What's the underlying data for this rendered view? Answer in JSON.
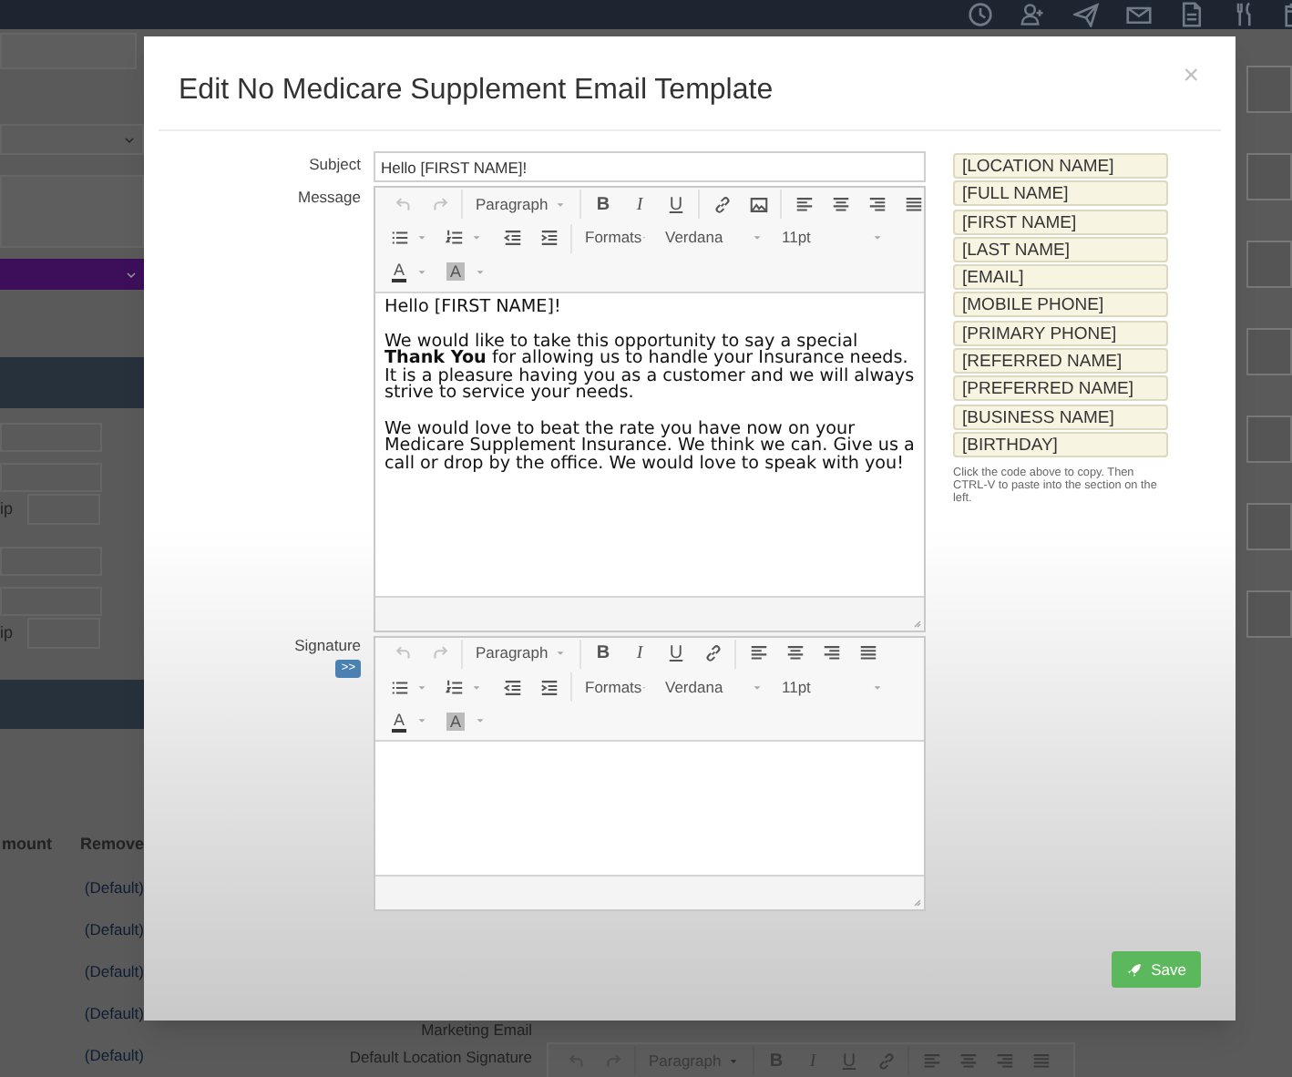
{
  "background_page": {
    "left_labels": [
      "ip",
      "ip"
    ],
    "table": {
      "columns": [
        "mount",
        "Remove"
      ],
      "rows": [
        "(Default)",
        "(Default)",
        "(Default)",
        "(Default)",
        "(Default)"
      ]
    },
    "bottom_labels": [
      "Marketing Email",
      "Default Location Signature"
    ],
    "bottom_toolbar": {
      "rows": [
        {
          "groups": [
            {
              "items": [
                {
                  "kind": "undo",
                  "disabled": true
                },
                {
                  "kind": "redo",
                  "disabled": true
                }
              ]
            },
            {
              "items": [
                {
                  "kind": "block-select",
                  "value": "Paragraph",
                  "disabled": false
                }
              ]
            },
            {
              "items": [
                {
                  "kind": "bold",
                  "label": "B",
                  "disabled": false
                },
                {
                  "kind": "italic",
                  "label": "I",
                  "disabled": false
                },
                {
                  "kind": "underline",
                  "label": "U",
                  "disabled": false
                },
                {
                  "kind": "link",
                  "disabled": false
                }
              ]
            },
            {
              "items": [
                {
                  "kind": "align-left",
                  "disabled": false
                },
                {
                  "kind": "align-center",
                  "disabled": false
                },
                {
                  "kind": "align-right",
                  "disabled": false
                },
                {
                  "kind": "justify",
                  "disabled": false
                }
              ]
            }
          ]
        }
      ]
    }
  },
  "modal": {
    "title": "Edit No Medicare Supplement Email Template",
    "close": "×",
    "subject": {
      "label": "Subject",
      "value": "Hello [FIRST NAME]!"
    },
    "message": {
      "label": "Message",
      "toolbar": {
        "rows": [
          {
            "groups": [
              {
                "items": [
                  {
                    "kind": "undo",
                    "disabled": true
                  },
                  {
                    "kind": "redo",
                    "disabled": true
                  }
                ]
              },
              {
                "items": [
                  {
                    "kind": "block-select",
                    "value": "Paragraph",
                    "disabled": false
                  }
                ]
              },
              {
                "items": [
                  {
                    "kind": "bold",
                    "label": "B",
                    "disabled": false
                  },
                  {
                    "kind": "italic",
                    "label": "I",
                    "disabled": false
                  },
                  {
                    "kind": "underline",
                    "label": "U",
                    "disabled": false
                  }
                ]
              },
              {
                "items": [
                  {
                    "kind": "link",
                    "disabled": false
                  },
                  {
                    "kind": "image",
                    "disabled": false
                  }
                ]
              },
              {
                "items": [
                  {
                    "kind": "align-left",
                    "disabled": false
                  },
                  {
                    "kind": "align-center",
                    "disabled": false
                  },
                  {
                    "kind": "align-right",
                    "disabled": false
                  },
                  {
                    "kind": "justify",
                    "disabled": false
                  }
                ]
              }
            ]
          },
          {
            "groups": [
              {
                "items": [
                  {
                    "kind": "bullet-list",
                    "disabled": false
                  },
                  {
                    "kind": "numbered-list",
                    "disabled": false
                  },
                  {
                    "kind": "outdent",
                    "disabled": false
                  },
                  {
                    "kind": "indent",
                    "disabled": false
                  }
                ]
              },
              {
                "items": [
                  {
                    "kind": "formats-menu",
                    "value": "Formats",
                    "disabled": false
                  },
                  {
                    "kind": "font-select",
                    "value": "Verdana",
                    "disabled": false
                  },
                  {
                    "kind": "size-select",
                    "value": "11pt",
                    "disabled": false
                  }
                ]
              }
            ]
          },
          {
            "groups": [
              {
                "items": [
                  {
                    "kind": "text-color",
                    "label": "A",
                    "disabled": false
                  },
                  {
                    "kind": "background-color",
                    "label": "A",
                    "disabled": false
                  }
                ]
              }
            ]
          }
        ]
      },
      "paragraphs": [
        "Hello [FIRST NAME]!",
        "We would like to take this opportunity to say a special **Thank You** for allowing us to handle your Insurance needs. It is a pleasure having you as a customer and we will always strive to service your needs.",
        "We would love to beat the rate you have now on your Medicare Supplement Insurance. We think we can. Give us a call or drop by the office. We would love to speak with you!"
      ]
    },
    "signature": {
      "label": "Signature",
      "toggle": ">>",
      "toolbar": {
        "rows": [
          {
            "groups": [
              {
                "items": [
                  {
                    "kind": "undo",
                    "disabled": true
                  },
                  {
                    "kind": "redo",
                    "disabled": true
                  }
                ]
              },
              {
                "items": [
                  {
                    "kind": "block-select",
                    "value": "Paragraph",
                    "disabled": false
                  }
                ]
              },
              {
                "items": [
                  {
                    "kind": "bold",
                    "label": "B",
                    "disabled": false
                  },
                  {
                    "kind": "italic",
                    "label": "I",
                    "disabled": false
                  },
                  {
                    "kind": "underline",
                    "label": "U",
                    "disabled": false
                  },
                  {
                    "kind": "link",
                    "disabled": false
                  }
                ]
              },
              {
                "items": [
                  {
                    "kind": "align-left",
                    "disabled": false
                  },
                  {
                    "kind": "align-center",
                    "disabled": false
                  },
                  {
                    "kind": "align-right",
                    "disabled": false
                  },
                  {
                    "kind": "justify",
                    "disabled": false
                  }
                ]
              }
            ]
          },
          {
            "groups": [
              {
                "items": [
                  {
                    "kind": "bullet-list",
                    "disabled": false
                  },
                  {
                    "kind": "numbered-list",
                    "disabled": false
                  },
                  {
                    "kind": "outdent",
                    "disabled": false
                  },
                  {
                    "kind": "indent",
                    "disabled": false
                  }
                ]
              },
              {
                "items": [
                  {
                    "kind": "formats-menu",
                    "value": "Formats",
                    "disabled": false
                  },
                  {
                    "kind": "font-select",
                    "value": "Verdana",
                    "disabled": false
                  },
                  {
                    "kind": "size-select",
                    "value": "11pt",
                    "disabled": false
                  }
                ]
              }
            ]
          },
          {
            "groups": [
              {
                "items": [
                  {
                    "kind": "text-color",
                    "label": "A",
                    "disabled": false
                  },
                  {
                    "kind": "background-color",
                    "label": "A",
                    "disabled": false
                  }
                ]
              }
            ]
          }
        ]
      }
    },
    "placeholders": [
      "[LOCATION NAME]",
      "[FULL NAME]",
      "[FIRST NAME]",
      "[LAST NAME]",
      "[EMAIL]",
      "[MOBILE PHONE]",
      "[PRIMARY PHONE]",
      "[REFERRED NAME]",
      "[PREFERRED NAME]",
      "[BUSINESS NAME]",
      "[BIRTHDAY]"
    ],
    "hint": "Click the code above to copy. Then CTRL-V to paste into the section on the left.",
    "save": "Save"
  }
}
